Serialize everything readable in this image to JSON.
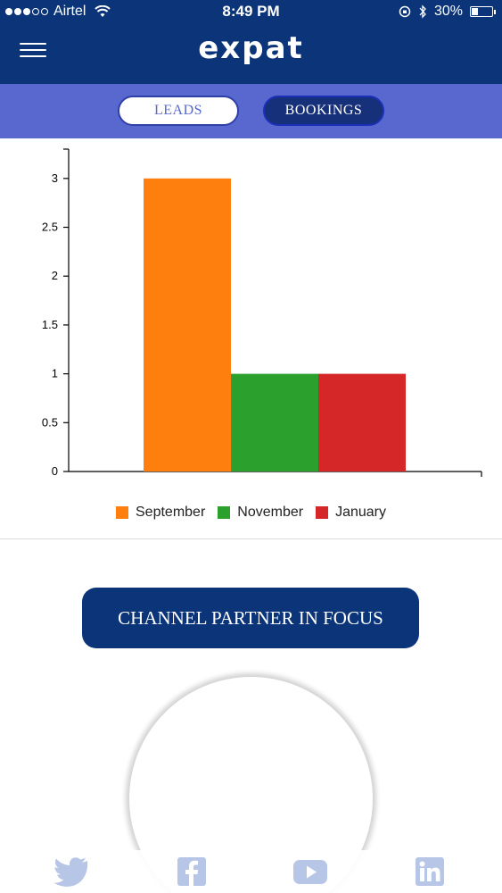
{
  "status_bar": {
    "carrier": "Airtel",
    "time": "8:49 PM",
    "battery": "30%",
    "battery_level": 0.3
  },
  "header": {
    "logo_text": "expat"
  },
  "tabs": [
    {
      "label": "LEADS",
      "active": false
    },
    {
      "label": "BOOKINGS",
      "active": true
    }
  ],
  "chart_data": {
    "type": "bar",
    "categories": [
      "September",
      "November",
      "January"
    ],
    "values": [
      3,
      1,
      1
    ],
    "colors": [
      "#ff7f0e",
      "#2ca02c",
      "#d62728"
    ],
    "yticks": [
      "0",
      "0.5",
      "1",
      "1.5",
      "2",
      "2.5",
      "3"
    ],
    "ylim": [
      0,
      3.3
    ],
    "legend": [
      "September",
      "November",
      "January"
    ],
    "legend_position": "bottom"
  },
  "focus": {
    "button_label": "CHANNEL PARTNER IN FOCUS"
  },
  "footer": {
    "icons": [
      "twitter-icon",
      "facebook-icon",
      "youtube-icon",
      "linkedin-icon"
    ],
    "icon_color": "#b7c6e6"
  }
}
